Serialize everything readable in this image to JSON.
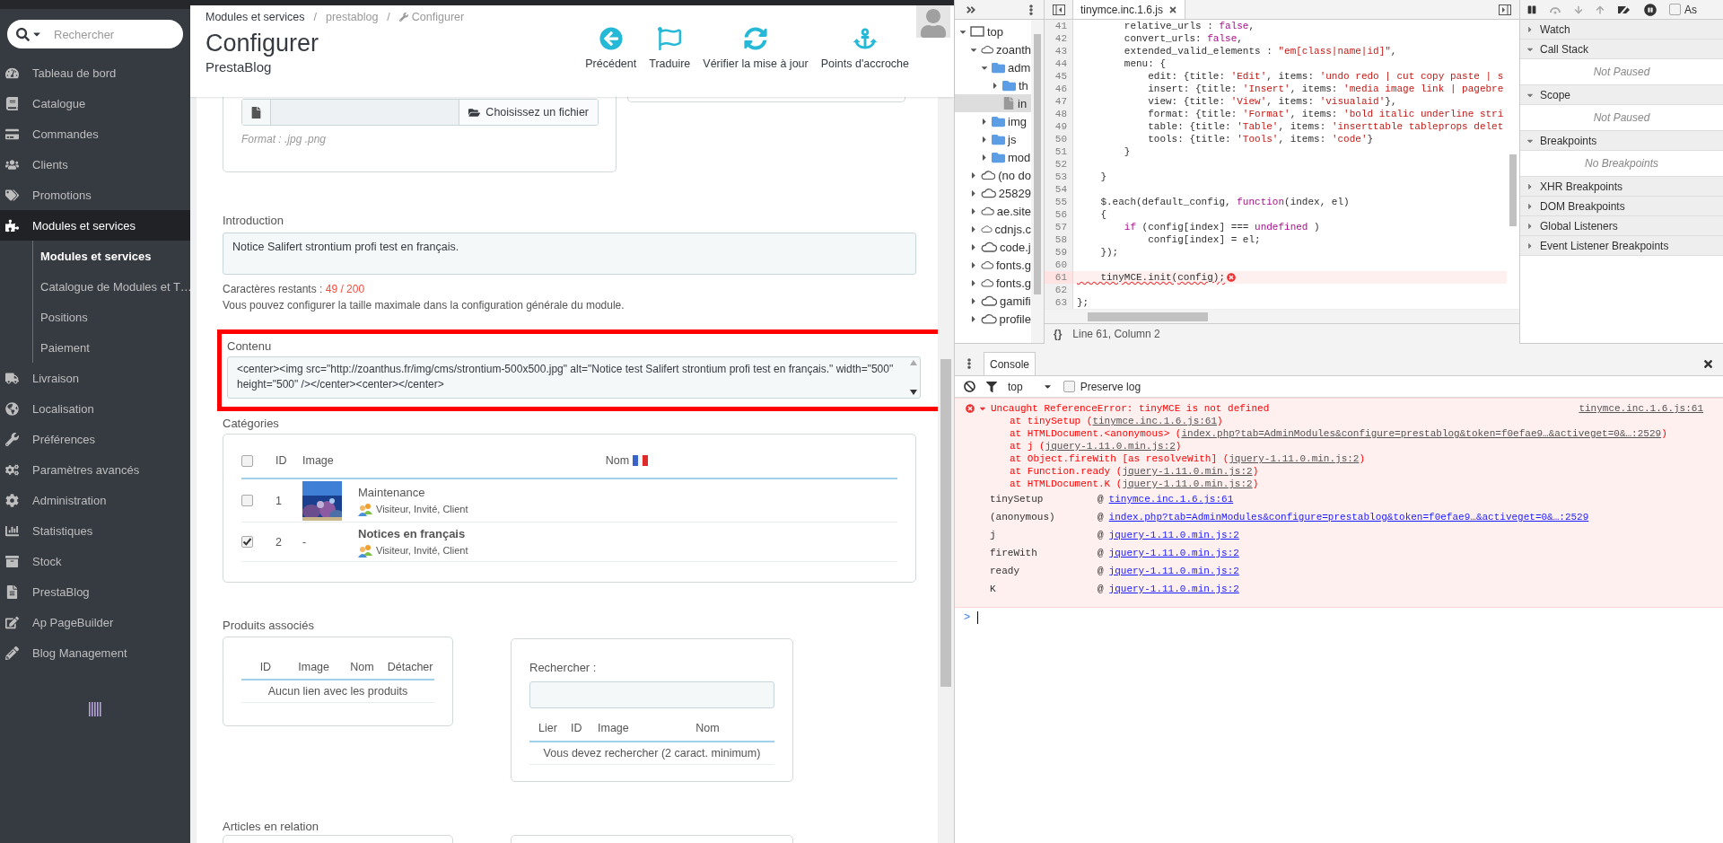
{
  "sidebar": {
    "search": {
      "placeholder": "Rechercher"
    },
    "items": [
      {
        "label": "Tableau de bord",
        "selected": false
      },
      {
        "label": "Catalogue",
        "selected": false
      },
      {
        "label": "Commandes",
        "selected": false
      },
      {
        "label": "Clients",
        "selected": false
      },
      {
        "label": "Promotions",
        "selected": false
      },
      {
        "label": "Modules et services",
        "selected": true,
        "children": [
          {
            "label": "Modules et services",
            "selected": true
          },
          {
            "label": "Catalogue de Modules et T…",
            "selected": false
          },
          {
            "label": "Positions",
            "selected": false
          },
          {
            "label": "Paiement",
            "selected": false
          }
        ]
      },
      {
        "label": "Livraison",
        "selected": false
      },
      {
        "label": "Localisation",
        "selected": false
      },
      {
        "label": "Préférences",
        "selected": false
      },
      {
        "label": "Paramètres avancés",
        "selected": false
      },
      {
        "label": "Administration",
        "selected": false
      },
      {
        "label": "Statistiques",
        "selected": false
      },
      {
        "label": "Stock",
        "selected": false
      },
      {
        "label": "PrestaBlog",
        "selected": false
      },
      {
        "label": "Ap PageBuilder",
        "selected": false
      },
      {
        "label": "Blog Management",
        "selected": false
      }
    ]
  },
  "header": {
    "breadcrumb": [
      {
        "label": "Modules et services"
      },
      {
        "label": "prestablog"
      },
      {
        "label": "Configurer"
      }
    ],
    "separator": "/",
    "title": "Configurer",
    "subtitle": "PrestaBlog",
    "actions": [
      {
        "label": "Précédent"
      },
      {
        "label": "Traduire"
      },
      {
        "label": "Vérifier la mise à jour"
      },
      {
        "label": "Points d'accroche"
      }
    ]
  },
  "form": {
    "image_upload": {
      "button": "Choisissez un fichier",
      "hint": "Format : .jpg .png"
    },
    "introduction": {
      "label": "Introduction",
      "value": "Notice Salifert strontium profi test en français.",
      "counter_label": "Caractères restants :",
      "counter": "49 / 200",
      "help": "Vous pouvez configurer la taille maximale dans la configuration générale du module."
    },
    "content": {
      "label": "Contenu",
      "highlighted": true,
      "value": "<center><img src=\"http://zoanthus.fr/img/cms/strontium-500x500.jpg\" alt=\"Notice test Salifert strontium profi test en français.\" width=\"500\" height=\"500\" /></center><center></center>"
    },
    "categories": {
      "label": "Catégories",
      "all_checked": false,
      "columns": [
        "ID",
        "Image",
        "Nom"
      ],
      "rows": [
        {
          "checked": false,
          "id": "1",
          "name": "Maintenance",
          "groups": "Visiteur, Invité, Client"
        },
        {
          "checked": true,
          "id": "2",
          "no_image": "-",
          "name": "Notices en français",
          "groups": "Visiteur, Invité, Client"
        }
      ]
    },
    "related_products": {
      "label": "Produits associés",
      "columns": [
        "ID",
        "Image",
        "Nom",
        "Détacher"
      ],
      "empty": "Aucun lien avec les produits",
      "search": {
        "label": "Rechercher :",
        "columns": [
          "Lier",
          "ID",
          "Image",
          "Nom"
        ],
        "empty": "Vous devez rechercher (2 caract. minimum)"
      }
    },
    "related_articles": {
      "label": "Articles en relation"
    }
  },
  "devtools": {
    "navigator": {
      "tree": [
        {
          "label": "top",
          "kind": "frame",
          "expanded": true,
          "selected": false,
          "children": [
            {
              "label": "zoanth",
              "kind": "domain",
              "expanded": true,
              "selected": false,
              "children": [
                {
                  "label": "adm",
                  "kind": "folder",
                  "expanded": true,
                  "selected": false,
                  "children": [
                    {
                      "label": "th",
                      "kind": "folder",
                      "expanded": false,
                      "selected": false
                    },
                    {
                      "label": "in",
                      "kind": "file",
                      "selected": true
                    }
                  ]
                },
                {
                  "label": "img",
                  "kind": "folder",
                  "expanded": false,
                  "selected": false
                },
                {
                  "label": "js",
                  "kind": "folder",
                  "expanded": false,
                  "selected": false
                },
                {
                  "label": "mod",
                  "kind": "folder",
                  "expanded": false,
                  "selected": false
                }
              ]
            },
            {
              "label": "(no do",
              "kind": "domain",
              "expanded": false,
              "selected": false
            },
            {
              "label": "25829",
              "kind": "domain",
              "expanded": false,
              "selected": false
            },
            {
              "label": "ae.site",
              "kind": "domain",
              "expanded": false,
              "selected": false
            },
            {
              "label": "cdnjs.c",
              "kind": "domain",
              "expanded": false,
              "selected": false
            },
            {
              "label": "code.j",
              "kind": "domain",
              "expanded": false,
              "selected": false
            },
            {
              "label": "fonts.g",
              "kind": "domain",
              "expanded": false,
              "selected": false
            },
            {
              "label": "fonts.g",
              "kind": "domain",
              "expanded": false,
              "selected": false
            },
            {
              "label": "gamifi",
              "kind": "domain",
              "expanded": false,
              "selected": false
            },
            {
              "label": "profile",
              "kind": "domain",
              "expanded": false,
              "selected": false
            }
          ]
        }
      ]
    },
    "editor": {
      "tab": "tinymce.inc.1.6.js",
      "status": "Line 61, Column 2",
      "format_button": "{}",
      "lines": [
        {
          "number": "41",
          "error": false,
          "tokens": [
            {
              "kind": "plain",
              "text": "        relative_urls : "
            },
            {
              "kind": "keyword",
              "text": "false"
            },
            {
              "kind": "plain",
              "text": ","
            }
          ]
        },
        {
          "number": "42",
          "error": false,
          "tokens": [
            {
              "kind": "plain",
              "text": "        convert_urls: "
            },
            {
              "kind": "keyword",
              "text": "false"
            },
            {
              "kind": "plain",
              "text": ","
            }
          ]
        },
        {
          "number": "43",
          "error": false,
          "tokens": [
            {
              "kind": "plain",
              "text": "        extended_valid_elements : "
            },
            {
              "kind": "string",
              "text": "\"em[class|name|id]\""
            },
            {
              "kind": "plain",
              "text": ","
            }
          ]
        },
        {
          "number": "44",
          "error": false,
          "tokens": [
            {
              "kind": "plain",
              "text": "        menu: {"
            }
          ]
        },
        {
          "number": "45",
          "error": false,
          "tokens": [
            {
              "kind": "plain",
              "text": "            edit: {title: "
            },
            {
              "kind": "string",
              "text": "'Edit'"
            },
            {
              "kind": "plain",
              "text": ", items: "
            },
            {
              "kind": "string",
              "text": "'undo redo | cut copy paste | s"
            }
          ]
        },
        {
          "number": "46",
          "error": false,
          "tokens": [
            {
              "kind": "plain",
              "text": "            insert: {title: "
            },
            {
              "kind": "string",
              "text": "'Insert'"
            },
            {
              "kind": "plain",
              "text": ", items: "
            },
            {
              "kind": "string",
              "text": "'media image link | pagebre"
            }
          ]
        },
        {
          "number": "47",
          "error": false,
          "tokens": [
            {
              "kind": "plain",
              "text": "            view: {title: "
            },
            {
              "kind": "string",
              "text": "'View'"
            },
            {
              "kind": "plain",
              "text": ", items: "
            },
            {
              "kind": "string",
              "text": "'visualaid'"
            },
            {
              "kind": "plain",
              "text": "},"
            }
          ]
        },
        {
          "number": "48",
          "error": false,
          "tokens": [
            {
              "kind": "plain",
              "text": "            format: {title: "
            },
            {
              "kind": "string",
              "text": "'Format'"
            },
            {
              "kind": "plain",
              "text": ", items: "
            },
            {
              "kind": "string",
              "text": "'bold italic underline stri"
            }
          ]
        },
        {
          "number": "49",
          "error": false,
          "tokens": [
            {
              "kind": "plain",
              "text": "            table: {title: "
            },
            {
              "kind": "string",
              "text": "'Table'"
            },
            {
              "kind": "plain",
              "text": ", items: "
            },
            {
              "kind": "string",
              "text": "'inserttable tableprops delet"
            }
          ]
        },
        {
          "number": "50",
          "error": false,
          "tokens": [
            {
              "kind": "plain",
              "text": "            tools: {title: "
            },
            {
              "kind": "string",
              "text": "'Tools'"
            },
            {
              "kind": "plain",
              "text": ", items: "
            },
            {
              "kind": "string",
              "text": "'code'"
            },
            {
              "kind": "plain",
              "text": "}"
            }
          ]
        },
        {
          "number": "51",
          "error": false,
          "tokens": [
            {
              "kind": "plain",
              "text": "        }"
            }
          ]
        },
        {
          "number": "52",
          "error": false
        },
        {
          "number": "53",
          "error": false,
          "tokens": [
            {
              "kind": "plain",
              "text": "    }"
            }
          ]
        },
        {
          "number": "54",
          "error": false
        },
        {
          "number": "55",
          "error": false,
          "tokens": [
            {
              "kind": "plain",
              "text": "    $.each(default_config, "
            },
            {
              "kind": "keyword",
              "text": "function"
            },
            {
              "kind": "plain",
              "text": "(index, el)"
            }
          ]
        },
        {
          "number": "56",
          "error": false,
          "tokens": [
            {
              "kind": "plain",
              "text": "    {"
            }
          ]
        },
        {
          "number": "57",
          "error": false,
          "tokens": [
            {
              "kind": "keyword",
              "text": "        if"
            },
            {
              "kind": "plain",
              "text": " (config[index] === "
            },
            {
              "kind": "keyword",
              "text": "undefined"
            },
            {
              "kind": "plain",
              "text": " )"
            }
          ]
        },
        {
          "number": "58",
          "error": false,
          "tokens": [
            {
              "kind": "plain",
              "text": "            config[index] = el;"
            }
          ]
        },
        {
          "number": "59",
          "error": false,
          "tokens": [
            {
              "kind": "plain",
              "text": "    });"
            }
          ]
        },
        {
          "number": "60",
          "error": false
        },
        {
          "number": "61",
          "error": true,
          "tokens": [
            {
              "kind": "plain",
              "text": "    tinyMCE.init(config);"
            }
          ]
        },
        {
          "number": "62",
          "error": false
        },
        {
          "number": "63",
          "error": false,
          "tokens": [
            {
              "kind": "plain",
              "text": "};"
            }
          ]
        }
      ]
    },
    "debugger": {
      "async": {
        "label": "As",
        "checked": false
      },
      "sections": [
        {
          "title": "Watch",
          "expanded": false
        },
        {
          "title": "Call Stack",
          "expanded": true,
          "status": "Not Paused"
        },
        {
          "title": "Scope",
          "expanded": true,
          "status": "Not Paused"
        },
        {
          "title": "Breakpoints",
          "expanded": true,
          "status": "No Breakpoints"
        },
        {
          "title": "XHR Breakpoints",
          "expanded": false
        },
        {
          "title": "DOM Breakpoints",
          "expanded": false
        },
        {
          "title": "Global Listeners",
          "expanded": false
        },
        {
          "title": "Event Listener Breakpoints",
          "expanded": false
        }
      ]
    },
    "console": {
      "tab": "Console",
      "context": "top",
      "preserve_log": {
        "label": "Preserve log",
        "checked": false
      },
      "error": {
        "message": "Uncaught ReferenceError: tinyMCE is not defined",
        "source": "tinymce.inc.1.6.js:61",
        "expanded": true,
        "trace": [
          {
            "prefix": "at tinySetup (",
            "link": "tinymce.inc.1.6.js:61",
            "suffix": ")"
          },
          {
            "prefix": "at HTMLDocument.<anonymous> (",
            "link": "index.php?tab=AdminModules&configure=prestablog&token=f0efae9…&activeget=0&…:2529",
            "suffix": ")"
          },
          {
            "prefix": "at j (",
            "link": "jquery-1.11.0.min.js:2",
            "suffix": ")"
          },
          {
            "prefix": "at Object.fireWith [as resolveWith] (",
            "link": "jquery-1.11.0.min.js:2",
            "suffix": ")"
          },
          {
            "prefix": "at Function.ready (",
            "link": "jquery-1.11.0.min.js:2",
            "suffix": ")"
          },
          {
            "prefix": "at HTMLDocument.K (",
            "link": "jquery-1.11.0.min.js:2",
            "suffix": ")"
          }
        ],
        "stack": [
          {
            "function": "tinySetup",
            "at": "@",
            "link": "tinymce.inc.1.6.js:61"
          },
          {
            "function": "(anonymous)",
            "at": "@",
            "link": "index.php?tab=AdminModules&configure=prestablog&token=f0efae9…&activeget=0&…:2529"
          },
          {
            "function": "j",
            "at": "@",
            "link": "jquery-1.11.0.min.js:2"
          },
          {
            "function": "fireWith",
            "at": "@",
            "link": "jquery-1.11.0.min.js:2"
          },
          {
            "function": "ready",
            "at": "@",
            "link": "jquery-1.11.0.min.js:2"
          },
          {
            "function": "K",
            "at": "@",
            "link": "jquery-1.11.0.min.js:2"
          }
        ]
      },
      "prompt": ">"
    }
  }
}
